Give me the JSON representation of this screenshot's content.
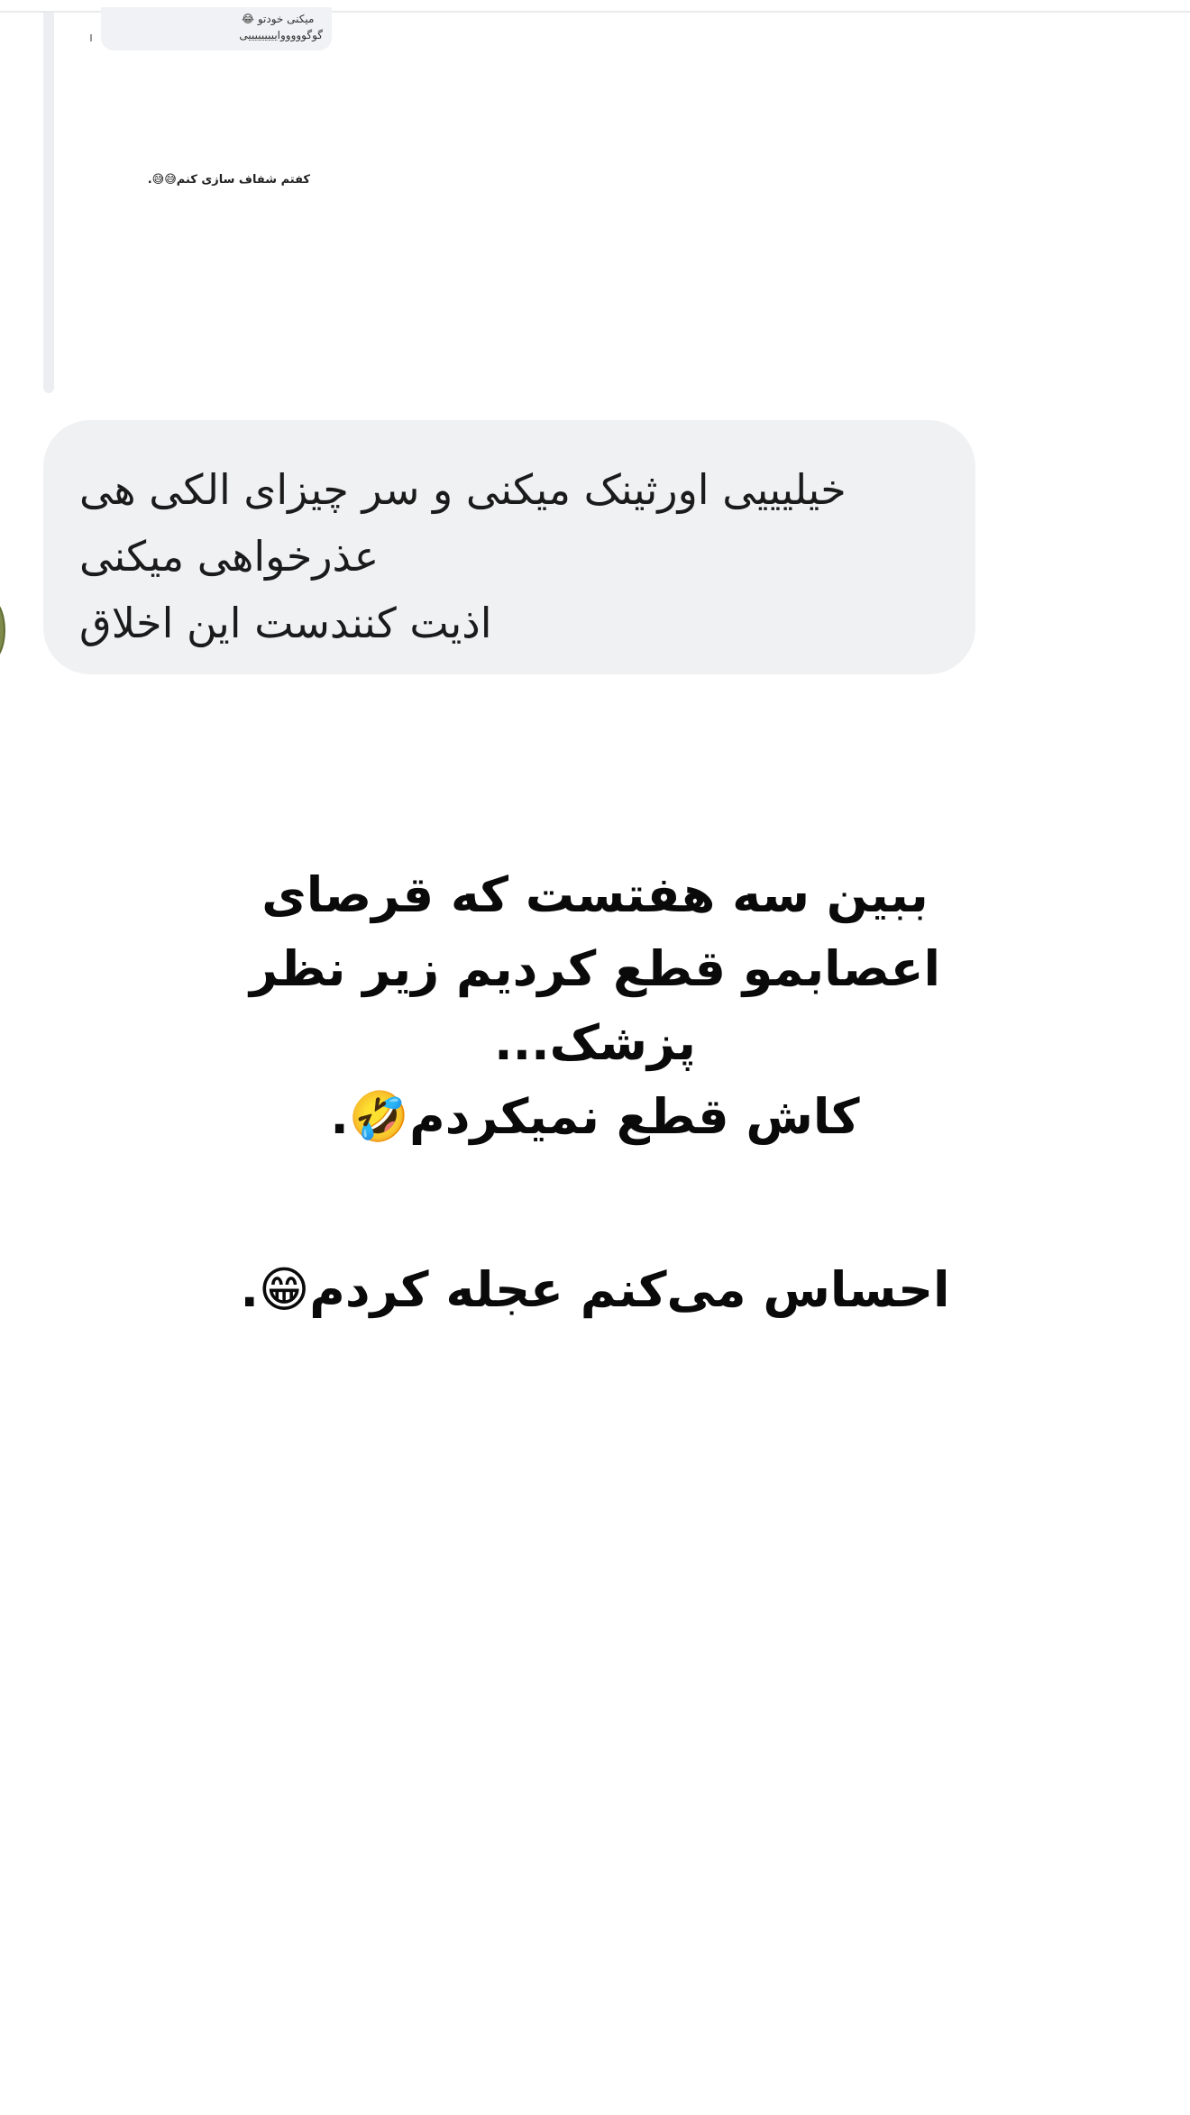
{
  "quoted_reply": {
    "line1": "میکنی خودتو 😂",
    "line2": "گوگوووووایییییییییی"
  },
  "caption": "کفتم شفاف سازی کنم😅😅.",
  "message": {
    "lines": [
      "خیلیییی اورثینک میکنی و سر چیزای الکی هی",
      "عذرخواهی میکنی",
      "اذیت کنندست این اخلاق"
    ]
  },
  "story": {
    "block1": [
      "ببین سه هفتست که قرصای",
      "اعصابمو قطع کردیم زیر نظر",
      "پزشک...",
      "کاش قطع نمیکردم🤣."
    ],
    "block2": [
      "احساس می‌کنم عجله کردم😁."
    ]
  }
}
